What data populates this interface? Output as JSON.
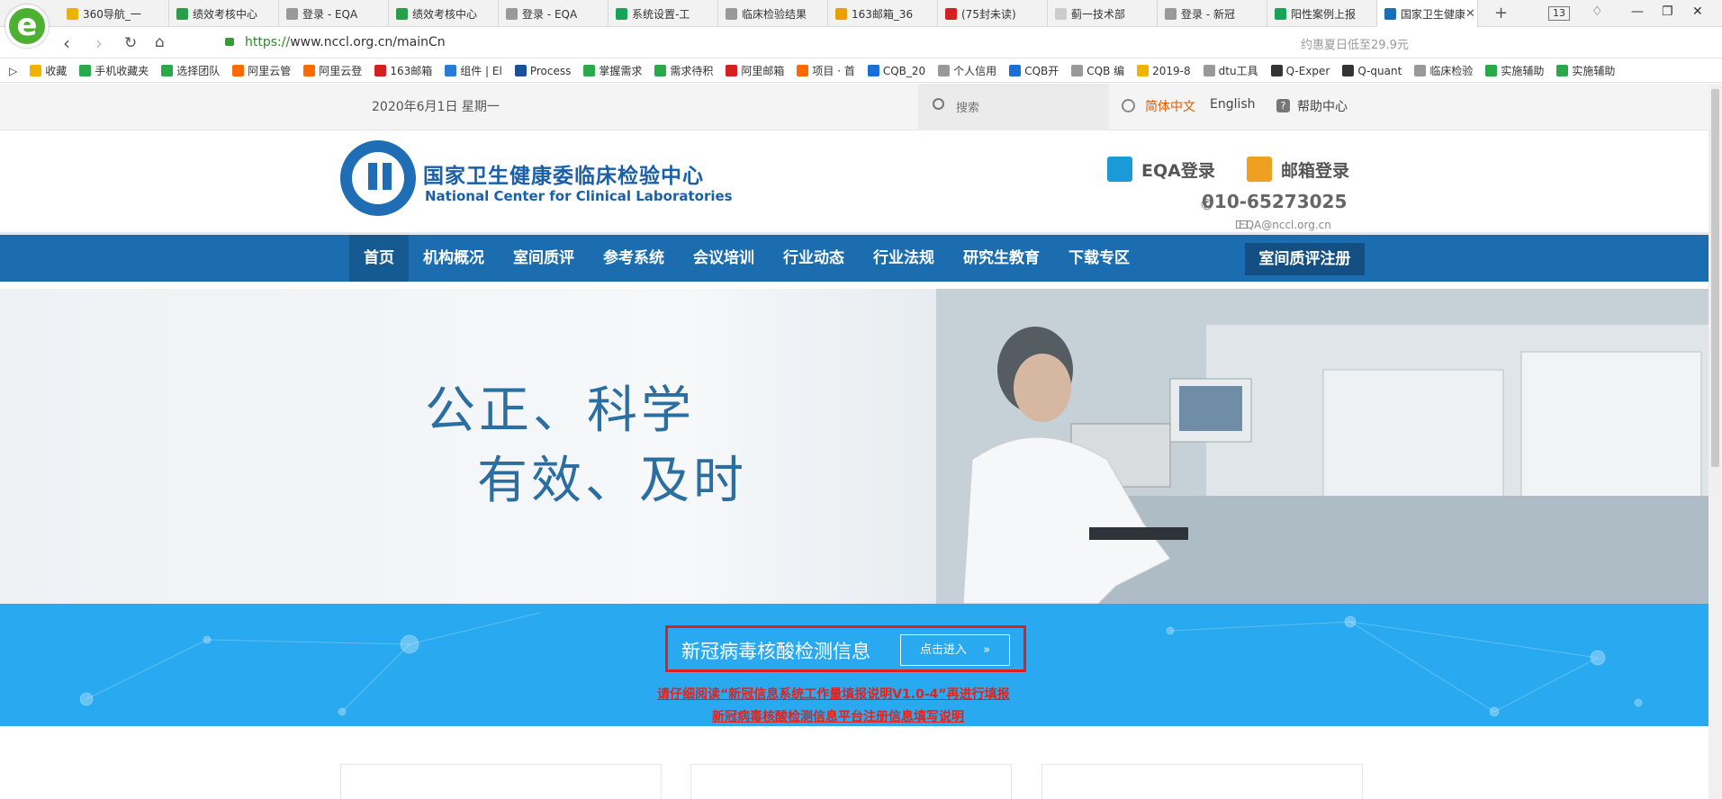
{
  "browser": {
    "tabs": [
      {
        "label": "360导航_一",
        "color": "#e8b400"
      },
      {
        "label": "绩效考核中心",
        "color": "#2a9d4a"
      },
      {
        "label": "登录 - EQA",
        "color": "#999999"
      },
      {
        "label": "绩效考核中心",
        "color": "#2a9d4a"
      },
      {
        "label": "登录 - EQA",
        "color": "#999999"
      },
      {
        "label": "系统设置-工",
        "color": "#19a25a"
      },
      {
        "label": "临床检验结果",
        "color": "#999999"
      },
      {
        "label": "163邮箱_36",
        "color": "#e8a000"
      },
      {
        "label": "(75封未读)",
        "color": "#d42020"
      },
      {
        "label": "蓟一技术部",
        "color": "#cccccc"
      },
      {
        "label": "登录 - 新冠",
        "color": "#999999"
      },
      {
        "label": "阳性案例上报",
        "color": "#19a25a"
      },
      {
        "label": "国家卫生健康",
        "color": "#1a6eb5",
        "active": true
      }
    ],
    "tab_count": "13",
    "url_scheme": "https://",
    "url_host": "www.nccl.org.cn",
    "url_path": "/mainCn",
    "ad_text": "约惠夏日低至29.9元",
    "bookmarks": [
      {
        "label": "收藏",
        "color": "#f0b400"
      },
      {
        "label": "手机收藏夹",
        "color": "#2aa84a"
      },
      {
        "label": "选择团队",
        "color": "#2aa84a"
      },
      {
        "label": "阿里云管",
        "color": "#ff6a00"
      },
      {
        "label": "阿里云登",
        "color": "#ff6a00"
      },
      {
        "label": "163邮箱",
        "color": "#d42020"
      },
      {
        "label": "组件 | El",
        "color": "#2a7ad6"
      },
      {
        "label": "Process",
        "color": "#1a4f9a"
      },
      {
        "label": "掌握需求",
        "color": "#2aa84a"
      },
      {
        "label": "需求待积",
        "color": "#2aa84a"
      },
      {
        "label": "阿里邮箱",
        "color": "#d42020"
      },
      {
        "label": "项目 · 首",
        "color": "#ff6a00"
      },
      {
        "label": "CQB_20",
        "color": "#1a6ed6"
      },
      {
        "label": "个人信用",
        "color": "#999999"
      },
      {
        "label": "CQB开",
        "color": "#1a6ed6"
      },
      {
        "label": "CQB 编",
        "color": "#999999"
      },
      {
        "label": "2019-8",
        "color": "#f0b400"
      },
      {
        "label": "dtu工具",
        "color": "#999999"
      },
      {
        "label": "Q-Exper",
        "color": "#333333"
      },
      {
        "label": "Q-quant",
        "color": "#333333"
      },
      {
        "label": "临床检验",
        "color": "#999999"
      },
      {
        "label": "实施辅助",
        "color": "#2aa84a"
      },
      {
        "label": "实施辅助",
        "color": "#2aa84a"
      }
    ]
  },
  "topbar": {
    "date": "2020年6月1日 星期一",
    "search_placeholder": "搜索",
    "lang_cn": "简体中文",
    "lang_en": "English",
    "help": "帮助中心"
  },
  "header": {
    "site_name_cn": "国家卫生健康委临床检验中心",
    "site_name_en": "National Center for Clinical Laboratories",
    "eqa_login": "EQA登录",
    "mail_login": "邮箱登录",
    "phone": "010-65273025",
    "email": "EQA@nccl.org.cn"
  },
  "nav": {
    "items": [
      "首页",
      "机构概况",
      "室间质评",
      "参考系统",
      "会议培训",
      "行业动态",
      "行业法规",
      "研究生教育",
      "下载专区"
    ],
    "register": "室间质评注册"
  },
  "banner": {
    "slogan_line1": "公正、科学",
    "slogan_line2": "有效、及时"
  },
  "covid": {
    "title": "新冠病毒核酸检测信息",
    "button": "点击进入",
    "link1": "请仔细阅读“新冠信息系统工作量填报说明V1.0-4”再进行填报",
    "link2": "新冠病毒核酸检测信息平台注册信息填写说明"
  },
  "colors": {
    "brand_blue": "#1c6db0",
    "covid_bg": "#29a9f0",
    "alert_red": "#e0231d",
    "lang_active": "#e05a00"
  }
}
